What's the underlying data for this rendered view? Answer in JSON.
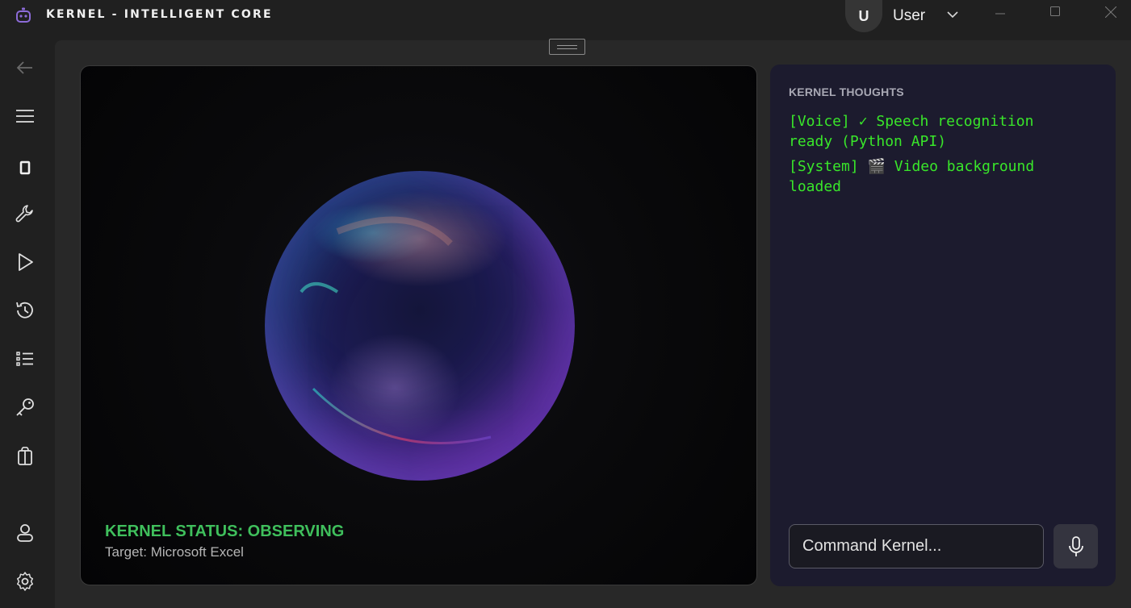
{
  "app": {
    "title": "KERNEL - INTELLIGENT CORE"
  },
  "user": {
    "initial": "U",
    "name": "User"
  },
  "sidebar": {
    "items": [
      {
        "name": "back",
        "icon": "back-arrow-icon"
      },
      {
        "name": "menu",
        "icon": "hamburger-icon"
      },
      {
        "name": "device",
        "icon": "device-icon"
      },
      {
        "name": "tools",
        "icon": "wrench-icon"
      },
      {
        "name": "run",
        "icon": "play-icon"
      },
      {
        "name": "history",
        "icon": "history-icon"
      },
      {
        "name": "list",
        "icon": "list-icon"
      },
      {
        "name": "key",
        "icon": "key-icon"
      },
      {
        "name": "gift",
        "icon": "gift-icon"
      },
      {
        "name": "account",
        "icon": "person-icon"
      },
      {
        "name": "settings",
        "icon": "gear-icon"
      }
    ]
  },
  "video": {
    "status": "KERNEL STATUS: OBSERVING",
    "target": "Target: Microsoft Excel"
  },
  "thoughts": {
    "title": "KERNEL THOUGHTS",
    "entries": [
      "[Voice] ✓ Speech recognition ready (Python API)",
      "[System] 🎬 Video background loaded"
    ]
  },
  "command": {
    "placeholder": "Command Kernel..."
  },
  "colors": {
    "accent_green": "#3fbf5c",
    "log_green": "#39e62a",
    "panel_bg": "#1c1b2e",
    "app_icon": "#8c6bd8"
  }
}
